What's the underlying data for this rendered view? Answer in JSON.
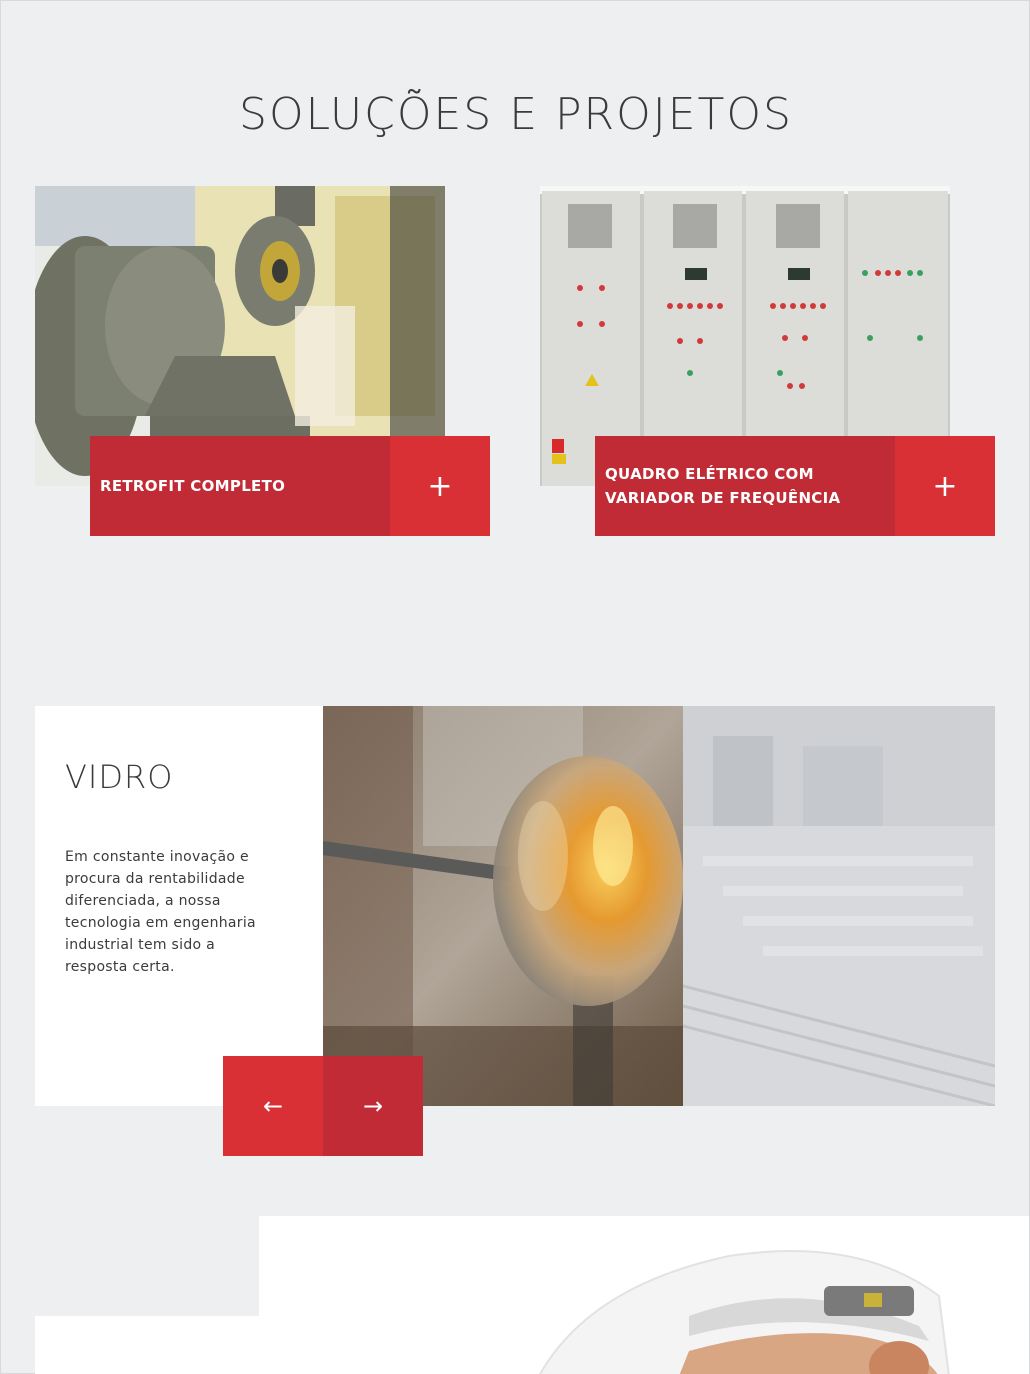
{
  "section": {
    "title": "SOLUÇÕES E PROJETOS"
  },
  "cards": [
    {
      "label": "RETROFIT COMPLETO",
      "plus": "+"
    },
    {
      "label": "QUADRO ELÉTRICO COM VARIADOR DE FREQUÊNCIA",
      "plus": "+"
    }
  ],
  "slider": {
    "title": "VIDRO",
    "text": "Em constante inovação e procura da rentabilidade diferenciada, a nossa tecnologia em engenharia industrial tem sido a resposta certa.",
    "prev": "←",
    "next": "→"
  },
  "colors": {
    "accent": "#d93035",
    "accent_dark": "#c02b35",
    "background": "#eeeff1"
  },
  "icons": {
    "plus": "plus-icon",
    "prev": "arrow-left-icon",
    "next": "arrow-right-icon"
  }
}
